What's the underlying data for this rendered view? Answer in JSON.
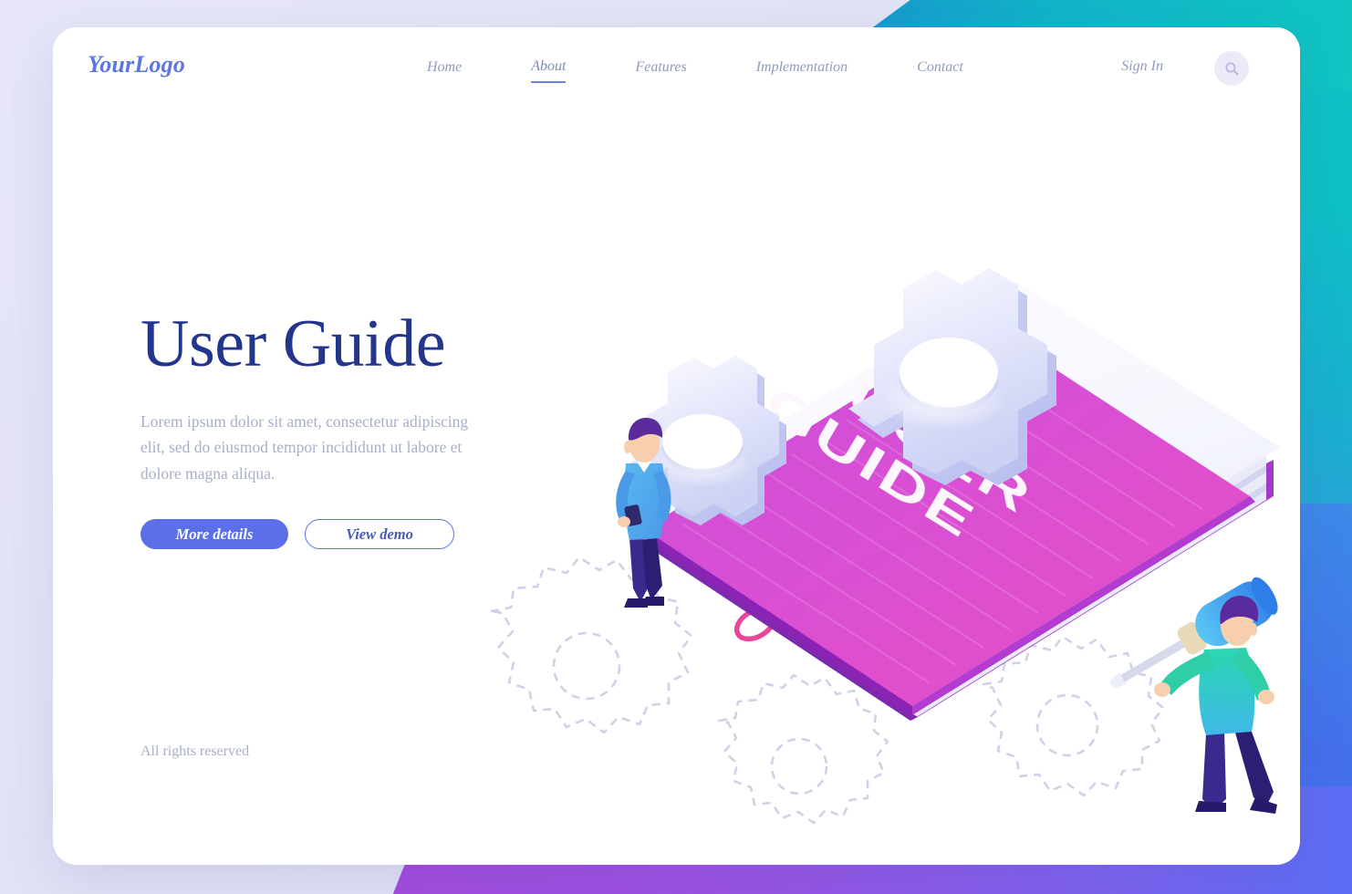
{
  "brand": {
    "logo": "YourLogo",
    "accent_blue": "#5a6fe8",
    "title_navy": "#24368c",
    "muted_text": "#a8b0c8",
    "nav_text": "#8e9bbd",
    "cover_pink": "#d94fd9",
    "spine_purple": "#8b2fb5"
  },
  "nav": {
    "items": [
      {
        "label": "Home",
        "active": false
      },
      {
        "label": "About",
        "active": true
      },
      {
        "label": "Features",
        "active": false
      },
      {
        "label": "Implementation",
        "active": false
      },
      {
        "label": "Contact",
        "active": false
      }
    ],
    "signin_label": "Sign In",
    "search_icon": "search-icon"
  },
  "hero": {
    "title": "User Guide",
    "paragraph": "Lorem ipsum dolor sit amet, consectetur adipiscing elit, sed do eiusmod tempor incididunt ut labore et dolore magna aliqua.",
    "primary_button": "More details",
    "secondary_button": "View demo"
  },
  "footer": {
    "rights": "All rights reserved"
  },
  "illustration": {
    "book_cover_line1": "USER",
    "book_cover_line2": "GUIDE",
    "elements": [
      "isometric-book",
      "gear-large",
      "gear-small",
      "dashed-gear-outlines",
      "person-with-phone",
      "person-with-screwdriver",
      "pink-key-markers"
    ]
  }
}
